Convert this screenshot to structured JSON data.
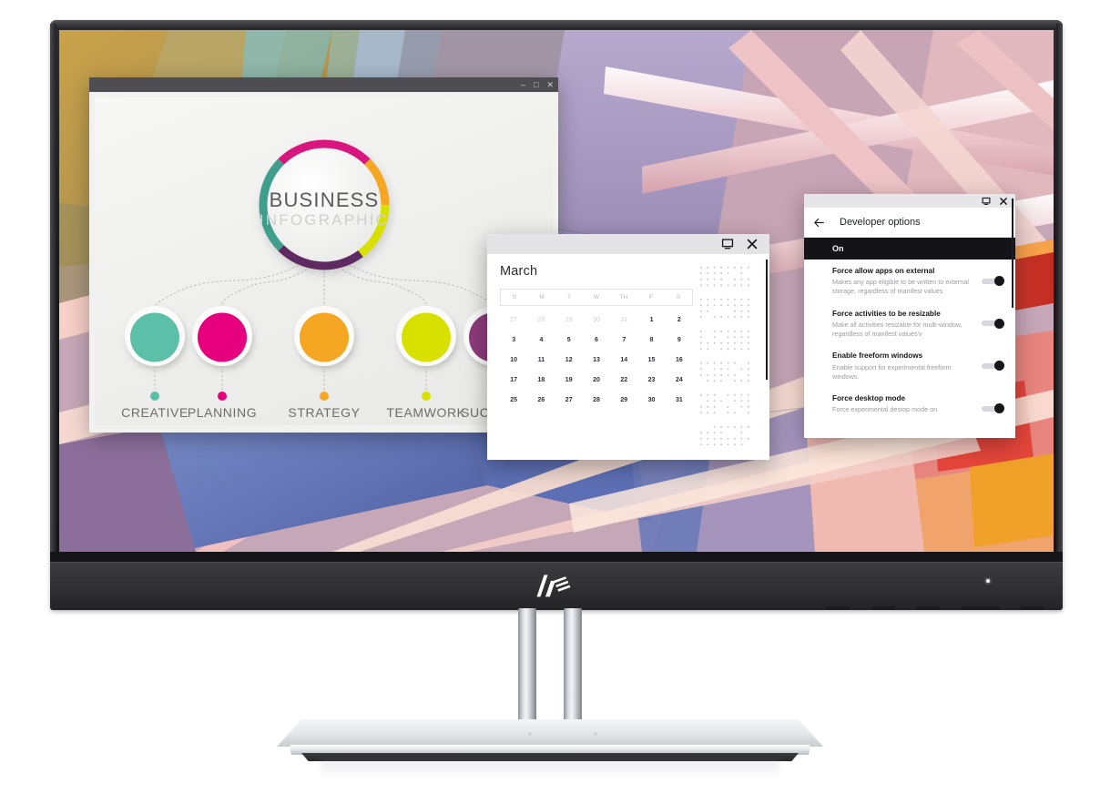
{
  "device": {
    "brand": "HP",
    "logo_name": "hp-logo",
    "bezel_color": "#1a1a1c",
    "stand_color": "#d7dade"
  },
  "desktop": {
    "wallpaper_name": "abstract-architecture-wallpaper",
    "wallpaper_colors": [
      "#c9a24a",
      "#e8a0a4",
      "#b5a0c8",
      "#6d7fc0",
      "#e0453a",
      "#6fc6e0",
      "#f2c36b"
    ]
  },
  "windows": {
    "infographic": {
      "title_controls": {
        "minimize": "–",
        "maximize": "□",
        "close": "✕"
      },
      "heading_line1": "BUSINESS",
      "heading_line2": "INFOGRAPHIC",
      "nodes": [
        {
          "label": "CREATIVE",
          "color": "#5cc0a8"
        },
        {
          "label": "PLANNING",
          "color": "#e6007e"
        },
        {
          "label": "STRATEGY",
          "color": "#f5a623"
        },
        {
          "label": "TEAMWORK",
          "color": "#d8e000"
        },
        {
          "label": "SUCCESS",
          "color": "#8e3b7c"
        }
      ],
      "ring_segments": [
        "#e6007e",
        "#f5a623",
        "#d8e000",
        "#8e3b7c",
        "#3f9e8c"
      ]
    },
    "calendar": {
      "titlebar_icons": [
        "display-icon",
        "close-icon"
      ],
      "month": "March",
      "day_headers": [
        "S",
        "M",
        "T",
        "W",
        "TH",
        "F",
        "S"
      ],
      "weeks": [
        [
          {
            "n": "27",
            "muted": true
          },
          {
            "n": "28",
            "muted": true
          },
          {
            "n": "29",
            "muted": true
          },
          {
            "n": "30",
            "muted": true
          },
          {
            "n": "31",
            "muted": true
          },
          {
            "n": "1",
            "muted": false
          },
          {
            "n": "2",
            "muted": false
          }
        ],
        [
          {
            "n": "3",
            "muted": false
          },
          {
            "n": "4",
            "muted": false
          },
          {
            "n": "5",
            "muted": false
          },
          {
            "n": "6",
            "muted": false
          },
          {
            "n": "7",
            "muted": false
          },
          {
            "n": "8",
            "muted": false
          },
          {
            "n": "9",
            "muted": false
          }
        ],
        [
          {
            "n": "10",
            "muted": false
          },
          {
            "n": "11",
            "muted": false
          },
          {
            "n": "12",
            "muted": false
          },
          {
            "n": "13",
            "muted": false
          },
          {
            "n": "14",
            "muted": false
          },
          {
            "n": "15",
            "muted": false
          },
          {
            "n": "16",
            "muted": false
          }
        ],
        [
          {
            "n": "17",
            "muted": false
          },
          {
            "n": "18",
            "muted": false
          },
          {
            "n": "19",
            "muted": false
          },
          {
            "n": "20",
            "muted": false
          },
          {
            "n": "22",
            "muted": false
          },
          {
            "n": "23",
            "muted": false
          },
          {
            "n": "24",
            "muted": false
          }
        ],
        [
          {
            "n": "25",
            "muted": false
          },
          {
            "n": "26",
            "muted": false
          },
          {
            "n": "27",
            "muted": false
          },
          {
            "n": "28",
            "muted": false
          },
          {
            "n": "29",
            "muted": false
          },
          {
            "n": "30",
            "muted": false
          },
          {
            "n": "31",
            "muted": false
          }
        ]
      ],
      "placeholder_blocks": 6
    },
    "developer_options": {
      "titlebar_icons": [
        "display-icon",
        "close-icon"
      ],
      "back_icon": "arrow-left-icon",
      "title": "Developer options",
      "master_switch_label": "On",
      "items": [
        {
          "title": "Force allow apps on external",
          "description": "Makes any app eligible to be written to external storage, regardless of manifest values",
          "toggle": "on"
        },
        {
          "title": "Force activities to be resizable",
          "description": "Make all activities resizable for multi-window, regardless of manifest values'v",
          "toggle": "on"
        },
        {
          "title": "Enable freeform windows",
          "description": "Enable support for experimental freeform windows.",
          "toggle": "on"
        },
        {
          "title": "Force desktop mode",
          "description": "Force experimental destop mode on",
          "toggle": "on"
        }
      ]
    }
  }
}
